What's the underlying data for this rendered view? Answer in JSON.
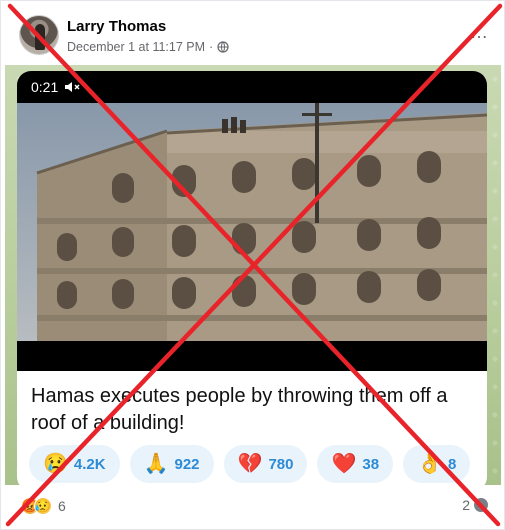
{
  "post": {
    "author": "Larry Thomas",
    "timestamp": "December 1 at 11:17 PM",
    "separator": "·",
    "more_icon": "more-options-icon"
  },
  "shared_screenshot": {
    "video": {
      "time": "0:21",
      "mute_icon": "speaker-muted-icon"
    },
    "caption": "Hamas executes people by throwing them off a roof of a building!",
    "reactions": [
      {
        "emoji": "😢",
        "count": "4.2K"
      },
      {
        "emoji": "🙏",
        "count": "922"
      },
      {
        "emoji": "💔",
        "count": "780"
      },
      {
        "emoji": "❤️",
        "count": "38"
      },
      {
        "emoji": "👌",
        "count": "8"
      }
    ]
  },
  "footer": {
    "reaction_count": "6",
    "comment_count": "2"
  },
  "overlay": {
    "type": "x-mark",
    "color": "#e8232a"
  }
}
